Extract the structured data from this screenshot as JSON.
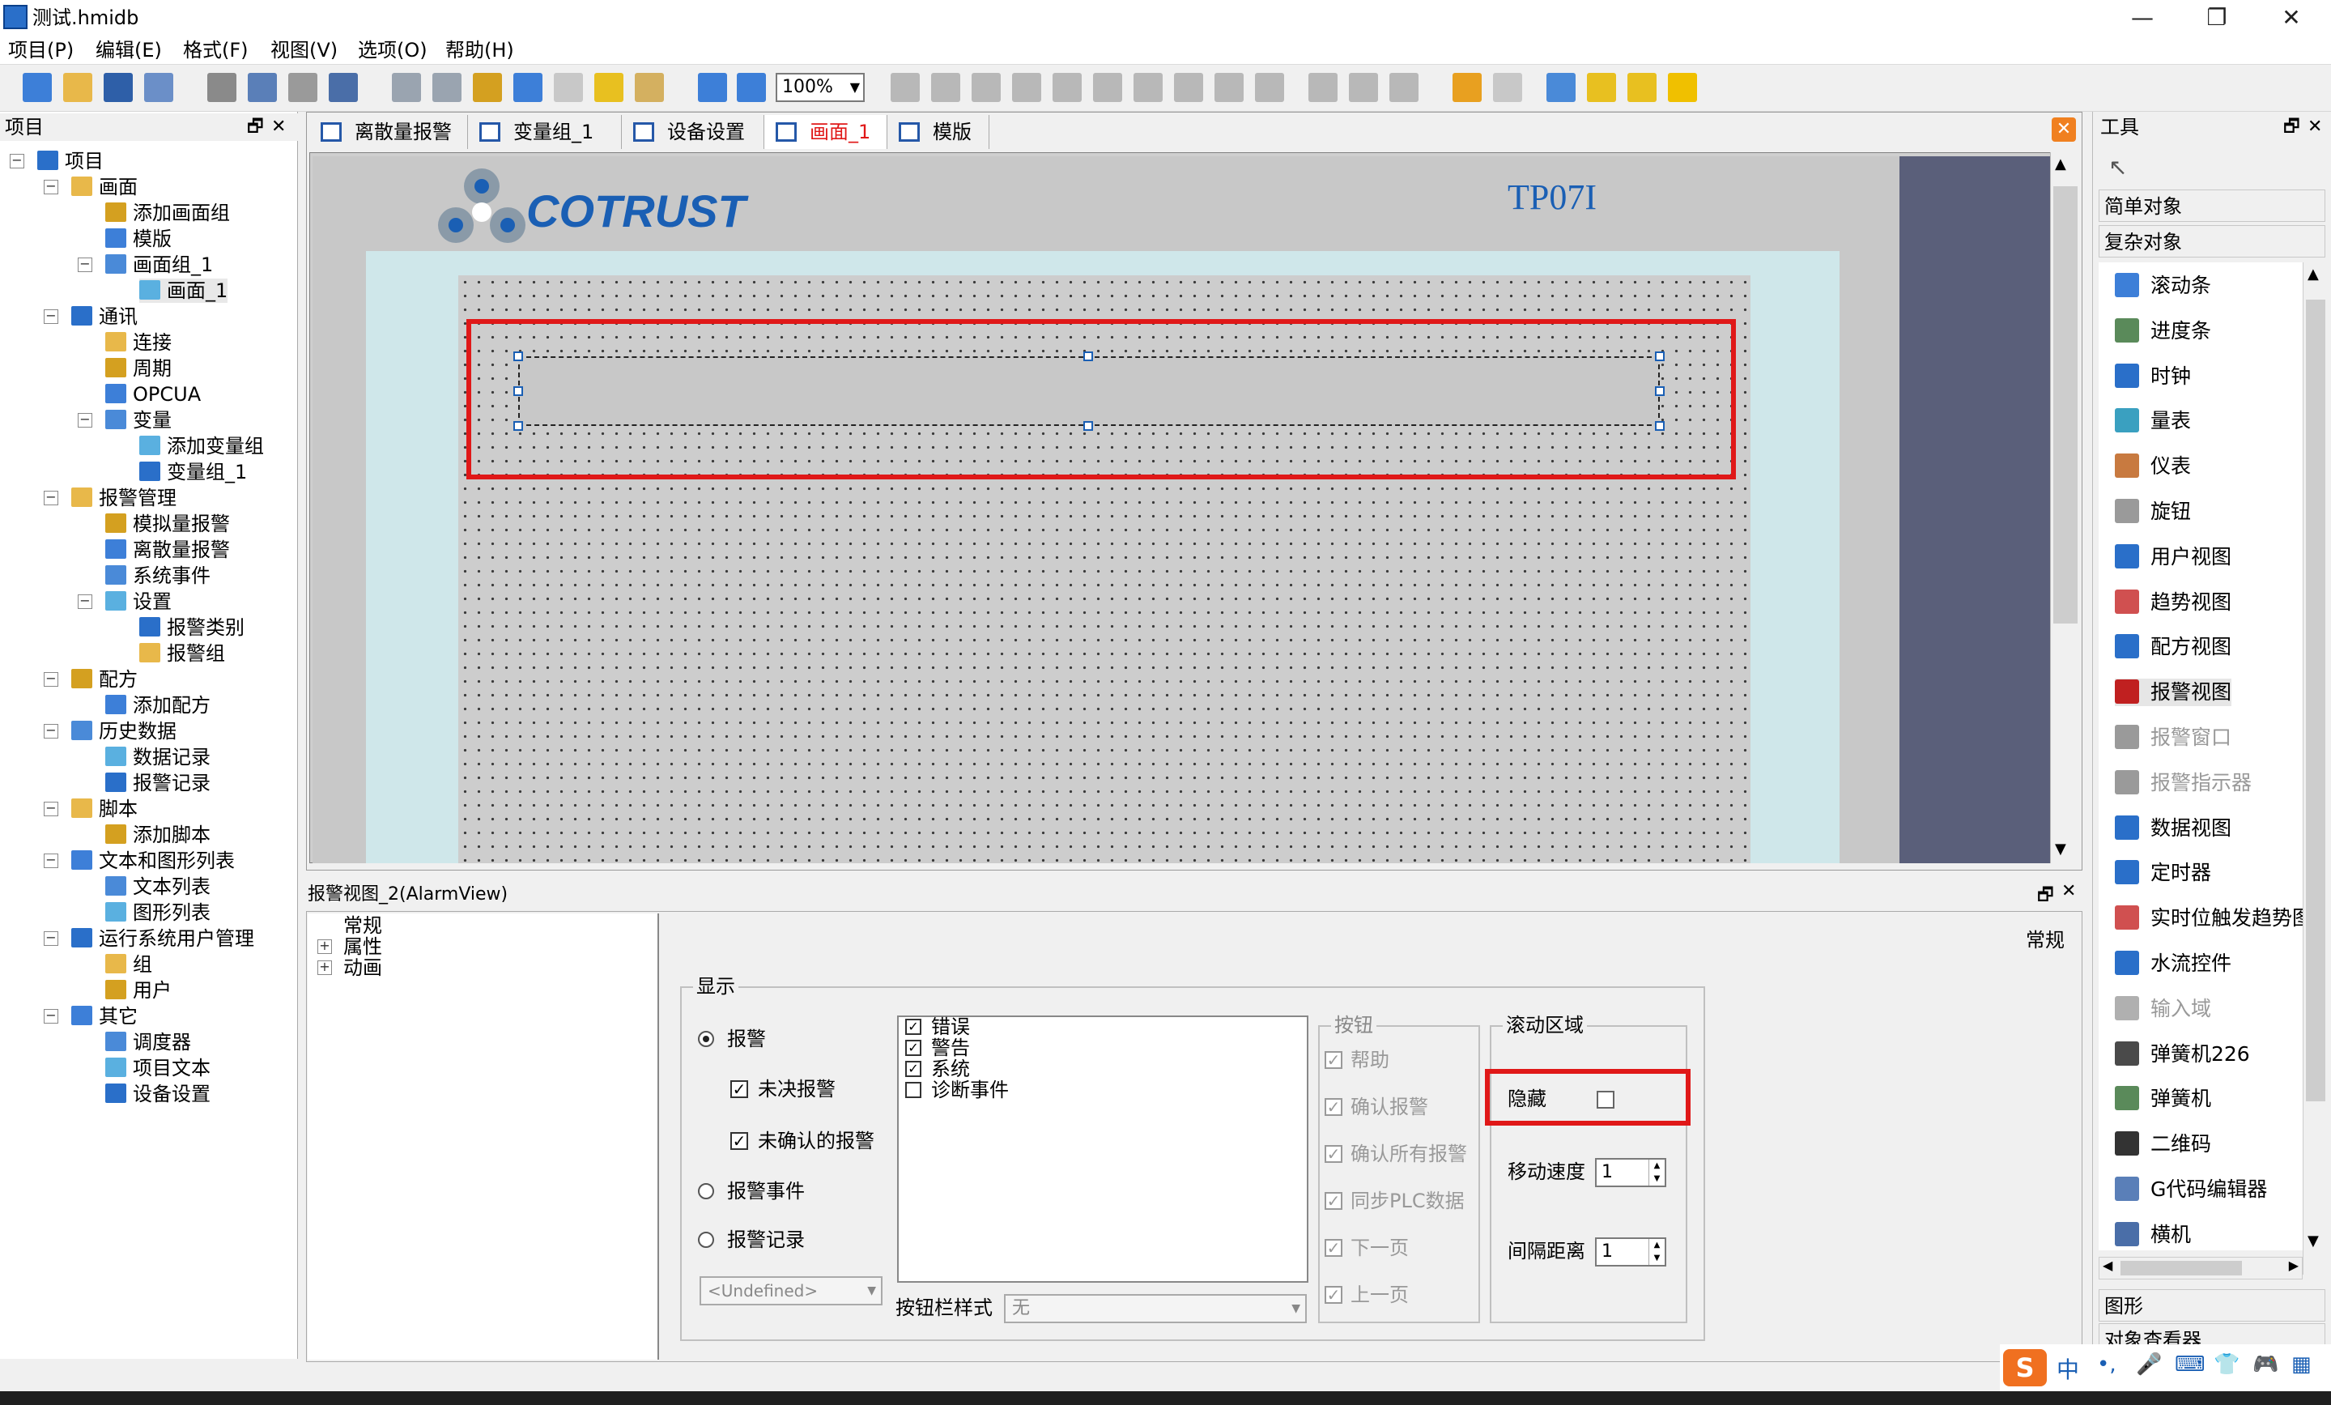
{
  "window": {
    "title": "测试.hmidb",
    "minimize": "—",
    "maximize": "❐",
    "close": "✕"
  },
  "menu": [
    "项目(P)",
    "编辑(E)",
    "格式(F)",
    "视图(V)",
    "选项(O)",
    "帮助(H)"
  ],
  "toolbar": {
    "zoom": "100%"
  },
  "project_panel": {
    "title": "项目",
    "tree": [
      {
        "label": "项目",
        "level": 0
      },
      {
        "label": "画面",
        "level": 1
      },
      {
        "label": "添加画面组",
        "level": 2
      },
      {
        "label": "模版",
        "level": 2
      },
      {
        "label": "画面组_1",
        "level": 2
      },
      {
        "label": "画面_1",
        "level": 3
      },
      {
        "label": "通讯",
        "level": 1
      },
      {
        "label": "连接",
        "level": 2
      },
      {
        "label": "周期",
        "level": 2
      },
      {
        "label": "OPCUA",
        "level": 2
      },
      {
        "label": "变量",
        "level": 2
      },
      {
        "label": "添加变量组",
        "level": 3
      },
      {
        "label": "变量组_1",
        "level": 3
      },
      {
        "label": "报警管理",
        "level": 1
      },
      {
        "label": "模拟量报警",
        "level": 2
      },
      {
        "label": "离散量报警",
        "level": 2
      },
      {
        "label": "系统事件",
        "level": 2
      },
      {
        "label": "设置",
        "level": 2
      },
      {
        "label": "报警类别",
        "level": 3
      },
      {
        "label": "报警组",
        "level": 3
      },
      {
        "label": "配方",
        "level": 1
      },
      {
        "label": "添加配方",
        "level": 2
      },
      {
        "label": "历史数据",
        "level": 1
      },
      {
        "label": "数据记录",
        "level": 2
      },
      {
        "label": "报警记录",
        "level": 2
      },
      {
        "label": "脚本",
        "level": 1
      },
      {
        "label": "添加脚本",
        "level": 2
      },
      {
        "label": "文本和图形列表",
        "level": 1
      },
      {
        "label": "文本列表",
        "level": 2
      },
      {
        "label": "图形列表",
        "level": 2
      },
      {
        "label": "运行系统用户管理",
        "level": 1
      },
      {
        "label": "组",
        "level": 2
      },
      {
        "label": "用户",
        "level": 2
      },
      {
        "label": "其它",
        "level": 1
      },
      {
        "label": "调度器",
        "level": 2
      },
      {
        "label": "项目文本",
        "level": 2
      },
      {
        "label": "设备设置",
        "level": 2
      }
    ]
  },
  "tabs": [
    {
      "label": "离散量报警",
      "active": false
    },
    {
      "label": "变量组_1",
      "active": false
    },
    {
      "label": "设备设置",
      "active": false
    },
    {
      "label": "画面_1",
      "active": true
    },
    {
      "label": "模版",
      "active": false
    }
  ],
  "canvas": {
    "logo_text": "COTRUST",
    "device": "TP07I"
  },
  "properties": {
    "header": "报警视图_2(AlarmView)",
    "tree": [
      "常规",
      "属性",
      "动画"
    ],
    "section_title": "常规",
    "display_group": "显示",
    "radio_alarm": "报警",
    "chk_unresolved": "未决报警",
    "chk_unack": "未确认的报警",
    "radio_event": "报警事件",
    "radio_record": "报警记录",
    "undefined_select": "<Undefined>",
    "classes": [
      {
        "label": "错误",
        "checked": true
      },
      {
        "label": "警告",
        "checked": true
      },
      {
        "label": "系统",
        "checked": true
      },
      {
        "label": "诊断事件",
        "checked": false
      }
    ],
    "button_style_label": "按钮栏样式",
    "button_style_value": "无",
    "buttons_group": "按钮",
    "buttons": [
      "帮助",
      "确认报警",
      "确认所有报警",
      "同步PLC数据",
      "下一页",
      "上一页"
    ],
    "scroll_group": "滚动区域",
    "hide_label": "隐藏",
    "move_speed_label": "移动速度",
    "move_speed_value": "1",
    "interval_label": "间隔距离",
    "interval_value": "1"
  },
  "tools_panel": {
    "title": "工具",
    "simple_objects": "简单对象",
    "complex_objects": "复杂对象",
    "items": [
      "滚动条",
      "进度条",
      "时钟",
      "量表",
      "仪表",
      "旋钮",
      "用户视图",
      "趋势视图",
      "配方视图",
      "报警视图",
      "报警窗口",
      "报警指示器",
      "数据视图",
      "定时器",
      "实时位触发趋势图",
      "水流控件",
      "输入域",
      "弹簧机226",
      "弹簧机",
      "二维码",
      "G代码编辑器",
      "横机"
    ],
    "disabled_items": [
      "报警窗口",
      "报警指示器",
      "输入域"
    ],
    "graphics": "图形",
    "object_viewer": "对象查看器"
  },
  "ime": {
    "lang": "中"
  },
  "colors": {
    "accent_red": "#e01818",
    "canvas_dark": "#5a5f7a",
    "screen_bg": "#cfe7ea",
    "link_blue": "#1a5fb4"
  }
}
